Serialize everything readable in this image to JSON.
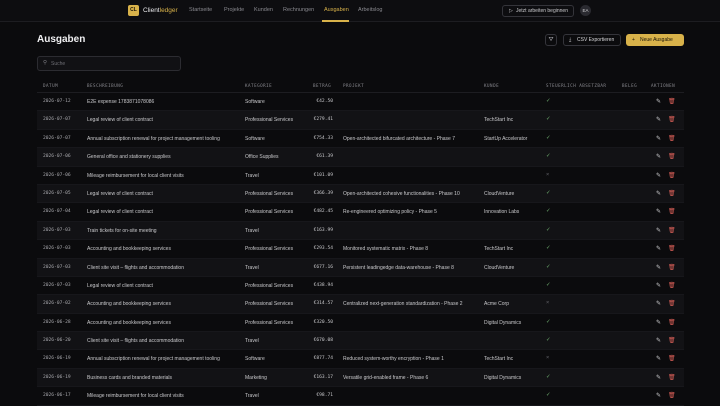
{
  "app": {
    "logo_text": "CL",
    "brand_main": "Client",
    "brand_accent": "ledger"
  },
  "nav": [
    "Startseite",
    "Projekte",
    "Kunden",
    "Rechnungen",
    "Ausgaben",
    "Arbeitslog"
  ],
  "nav_active_index": 4,
  "header": {
    "timer_label": "Jetzt arbeiten beginnen",
    "avatar_initials": "EA"
  },
  "page": {
    "title": "Ausgaben",
    "csv_label": "CSV Exportieren",
    "new_label": "Neue Ausgabe"
  },
  "search": {
    "placeholder": "Suche",
    "value": ""
  },
  "columns": [
    "DATUM",
    "BESCHREIBUNG",
    "KATEGORIE",
    "BETRAG",
    "PROJEKT",
    "KUNDE",
    "STEUERLICH ABSETZBAR",
    "BELEG",
    "AKTIONEN"
  ],
  "colors": {
    "accent": "#d8b24a",
    "deductible_yes": "#6fae6f",
    "deductible_no": "#6a6a70",
    "delete": "#e0625a"
  },
  "rows": [
    {
      "date": "2026-07-12",
      "desc": "E2E expense 1783871078086",
      "cat": "Software",
      "amount": "€42.50",
      "project": "",
      "client": "",
      "deductible": true
    },
    {
      "date": "2026-07-07",
      "desc": "Legal review of client contract",
      "cat": "Professional Services",
      "amount": "€279.41",
      "project": "",
      "client": "TechStart Inc",
      "deductible": true
    },
    {
      "date": "2026-07-07",
      "desc": "Annual subscription renewal for project management tooling",
      "cat": "Software",
      "amount": "€754.33",
      "project": "Open-architected bifurcated architecture - Phase 7",
      "client": "StartUp Accelerator",
      "deductible": true
    },
    {
      "date": "2026-07-06",
      "desc": "General office and stationery supplies",
      "cat": "Office Supplies",
      "amount": "€61.39",
      "project": "",
      "client": "",
      "deductible": true
    },
    {
      "date": "2026-07-06",
      "desc": "Mileage reimbursement for local client visits",
      "cat": "Travel",
      "amount": "€101.09",
      "project": "",
      "client": "",
      "deductible": false
    },
    {
      "date": "2026-07-05",
      "desc": "Legal review of client contract",
      "cat": "Professional Services",
      "amount": "€366.39",
      "project": "Open-architected cohesive functionalities - Phase 10",
      "client": "CloudVenture",
      "deductible": true
    },
    {
      "date": "2026-07-04",
      "desc": "Legal review of client contract",
      "cat": "Professional Services",
      "amount": "€482.45",
      "project": "Re-engineered optimizing policy - Phase 5",
      "client": "Innovation Labs",
      "deductible": true
    },
    {
      "date": "2026-07-03",
      "desc": "Train tickets for on-site meeting",
      "cat": "Travel",
      "amount": "€163.99",
      "project": "",
      "client": "",
      "deductible": true
    },
    {
      "date": "2026-07-03",
      "desc": "Accounting and bookkeeping services",
      "cat": "Professional Services",
      "amount": "€293.54",
      "project": "Monitored systematic matrix - Phase 8",
      "client": "TechStart Inc",
      "deductible": true
    },
    {
      "date": "2026-07-03",
      "desc": "Client site visit – flights and accommodation",
      "cat": "Travel",
      "amount": "€677.16",
      "project": "Persistent leadingedge data-warehouse - Phase 8",
      "client": "CloudVenture",
      "deductible": true
    },
    {
      "date": "2026-07-03",
      "desc": "Legal review of client contract",
      "cat": "Professional Services",
      "amount": "€438.94",
      "project": "",
      "client": "",
      "deductible": true
    },
    {
      "date": "2026-07-02",
      "desc": "Accounting and bookkeeping services",
      "cat": "Professional Services",
      "amount": "€314.57",
      "project": "Centralized next-generation standardization - Phase 2",
      "client": "Acme Corp",
      "deductible": false
    },
    {
      "date": "2026-06-28",
      "desc": "Accounting and bookkeeping services",
      "cat": "Professional Services",
      "amount": "€320.50",
      "project": "",
      "client": "Digital Dynamics",
      "deductible": true
    },
    {
      "date": "2026-06-20",
      "desc": "Client site visit – flights and accommodation",
      "cat": "Travel",
      "amount": "€670.08",
      "project": "",
      "client": "",
      "deductible": true
    },
    {
      "date": "2026-06-19",
      "desc": "Annual subscription renewal for project management tooling",
      "cat": "Software",
      "amount": "€877.74",
      "project": "Reduced system-worthy encryption - Phase 1",
      "client": "TechStart Inc",
      "deductible": false
    },
    {
      "date": "2026-06-19",
      "desc": "Business cards and branded materials",
      "cat": "Marketing",
      "amount": "€163.17",
      "project": "Versatile grid-enabled frame - Phase 6",
      "client": "Digital Dynamics",
      "deductible": true
    },
    {
      "date": "2026-06-17",
      "desc": "Mileage reimbursement for local client visits",
      "cat": "Travel",
      "amount": "€98.71",
      "project": "",
      "client": "",
      "deductible": true
    }
  ]
}
